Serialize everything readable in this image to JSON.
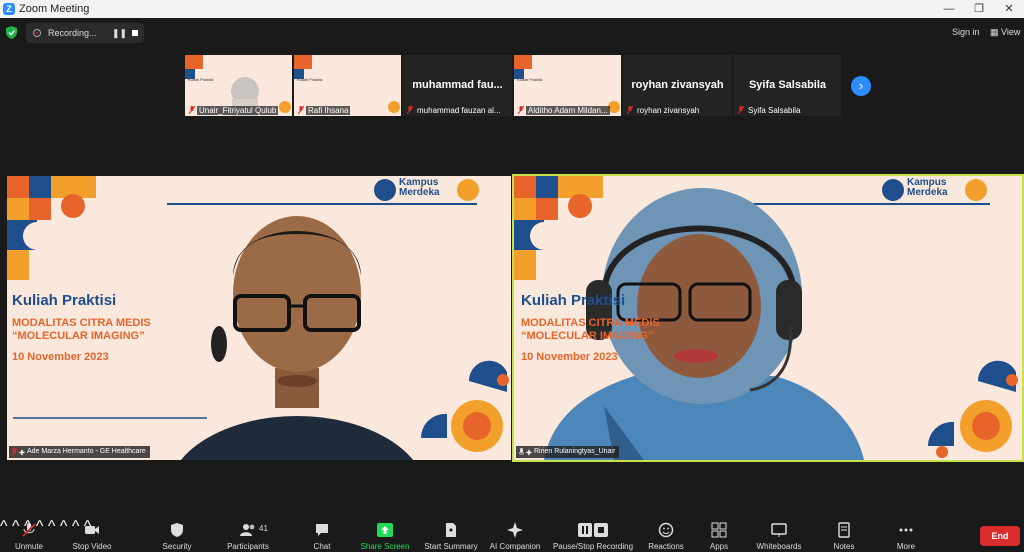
{
  "window": {
    "title": "Zoom Meeting",
    "minimize": "—",
    "maximize": "❐",
    "close": "✕"
  },
  "topbar": {
    "recording_label": "Recording...",
    "pause_symbol": "❚❚",
    "sign_in": "Sign in",
    "view_label": "View"
  },
  "participants_strip": [
    {
      "name": "Unair_Fitriyatul Qulub",
      "video": "slide"
    },
    {
      "name": "Rafi Ihsana",
      "video": "slide"
    },
    {
      "name": "muhammad fauzan al...",
      "display": "muhammad fau...",
      "video": "none"
    },
    {
      "name": "Alditho Adam Mildan...",
      "video": "slide"
    },
    {
      "name": "royhan zivansyah",
      "display": "royhan zivansyah",
      "video": "none"
    },
    {
      "name": "Syifa Salsabila",
      "display": "Syifa Salsabila",
      "video": "none"
    }
  ],
  "next_page_icon": "chevron-right-icon",
  "slide": {
    "heading": "Kuliah Praktisi",
    "subtitle_line1": "MODALITAS CITRA MEDIS",
    "subtitle_line2": "“MOLECULAR IMAGING”",
    "date": "10 November 2023",
    "brand_line1": "Kampus",
    "brand_line2": "Merdeka"
  },
  "speaker_left": {
    "name": "Ade Marza Hermanto - GE Healthcare"
  },
  "speaker_right": {
    "name": "Ririen Rulaningtyas_Unair"
  },
  "toolbar": {
    "unmute": "Unmute",
    "stop_video": "Stop Video",
    "security": "Security",
    "participants": "Participants",
    "participants_count": "41",
    "chat": "Chat",
    "share_screen": "Share Screen",
    "start_summary": "Start Summary",
    "ai_companion": "AI Companion",
    "pause_recording": "Pause/Stop Recording",
    "reactions": "Reactions",
    "apps": "Apps",
    "whiteboards": "Whiteboards",
    "notes": "Notes",
    "more": "More",
    "end": "End"
  },
  "colors": {
    "accent": "#2d8cff",
    "share_green": "#23d959",
    "end_red": "#d92c2c",
    "active_speaker": "#c6e24a",
    "slide_bg": "#fbe8dd",
    "slide_blue": "#1e4e8c",
    "slide_orange": "#e7642a"
  }
}
